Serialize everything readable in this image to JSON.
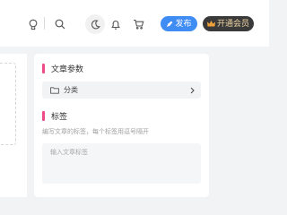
{
  "header": {
    "icons": [
      "lightbulb-icon",
      "search-icon",
      "moon-icon",
      "bell-icon",
      "cart-icon"
    ],
    "publish_label": "发布",
    "vip_label": "开通会员",
    "accent": "#3f8cf5",
    "vip_bg": "#3a3a3a"
  },
  "panel": {
    "params_title": "文章参数",
    "category_label": "分类",
    "tags_title": "标签",
    "tags_hint": "编写文章的标签，每个标签用逗号隔开",
    "tags_placeholder": "输入文章标签",
    "section_marker_color": "#ee4b8a"
  }
}
